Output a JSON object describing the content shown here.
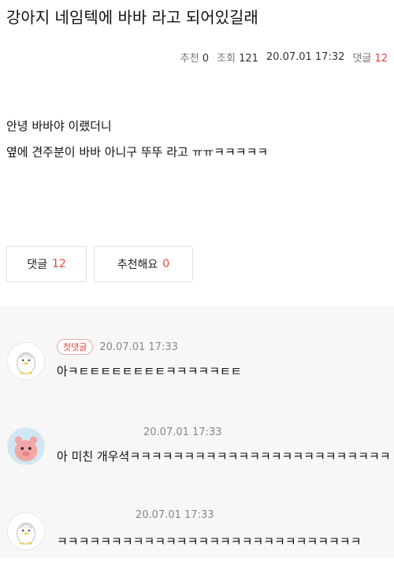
{
  "post": {
    "title": "강아지 네임텍에 바바 라고 되어있길래",
    "meta": {
      "recommend_label": "추천",
      "recommend_count": "0",
      "views_label": "조회",
      "views_count": "121",
      "date": "20.07.01 17:32",
      "comments_label": "댓글",
      "comments_count": "12"
    },
    "body_lines": [
      "안녕 바바야 이랬더니",
      "옆에 견주분이 바바 아니구 뚜뚜 라고 ㅠㅠㅋㅋㅋㅋㅋ"
    ]
  },
  "actions": {
    "comments_label": "댓글",
    "comments_count": "12",
    "recommend_label": "추천해요",
    "recommend_count": "0"
  },
  "colors": {
    "accent": "#e8433b",
    "comment_bg": "#f7f7f7"
  },
  "comments": [
    {
      "badge": "첫댓글",
      "time": "20.07.01 17:33",
      "text": "아ㅋㅌㅌㅌㅌㅌㅌㅌㅌㅋㅋㅋㅋㅋㅌㅌ",
      "avatar": "penguin-avatar"
    },
    {
      "badge": "",
      "time": "20.07.01 17:33",
      "text": "아 미친 개우셕ㅋㅋㅋㅋㅋㅋㅋㅋㅋㅋㅋㅋㅋㅋㅋㅋㅋㅋㅋㅋㅋㅋㅋㅋ",
      "avatar": "pink-character-avatar"
    },
    {
      "badge": "",
      "time": "20.07.01 17:33",
      "text": "ㅋㅋㅋㅋㅋㅋㅋㅋㅋㅋㅋㅋㅋㅋㅋㅋㅋㅋㅋㅋㅋㅋㅋㅋㅋㅋㅋㅋ",
      "avatar": "penguin-avatar"
    }
  ]
}
